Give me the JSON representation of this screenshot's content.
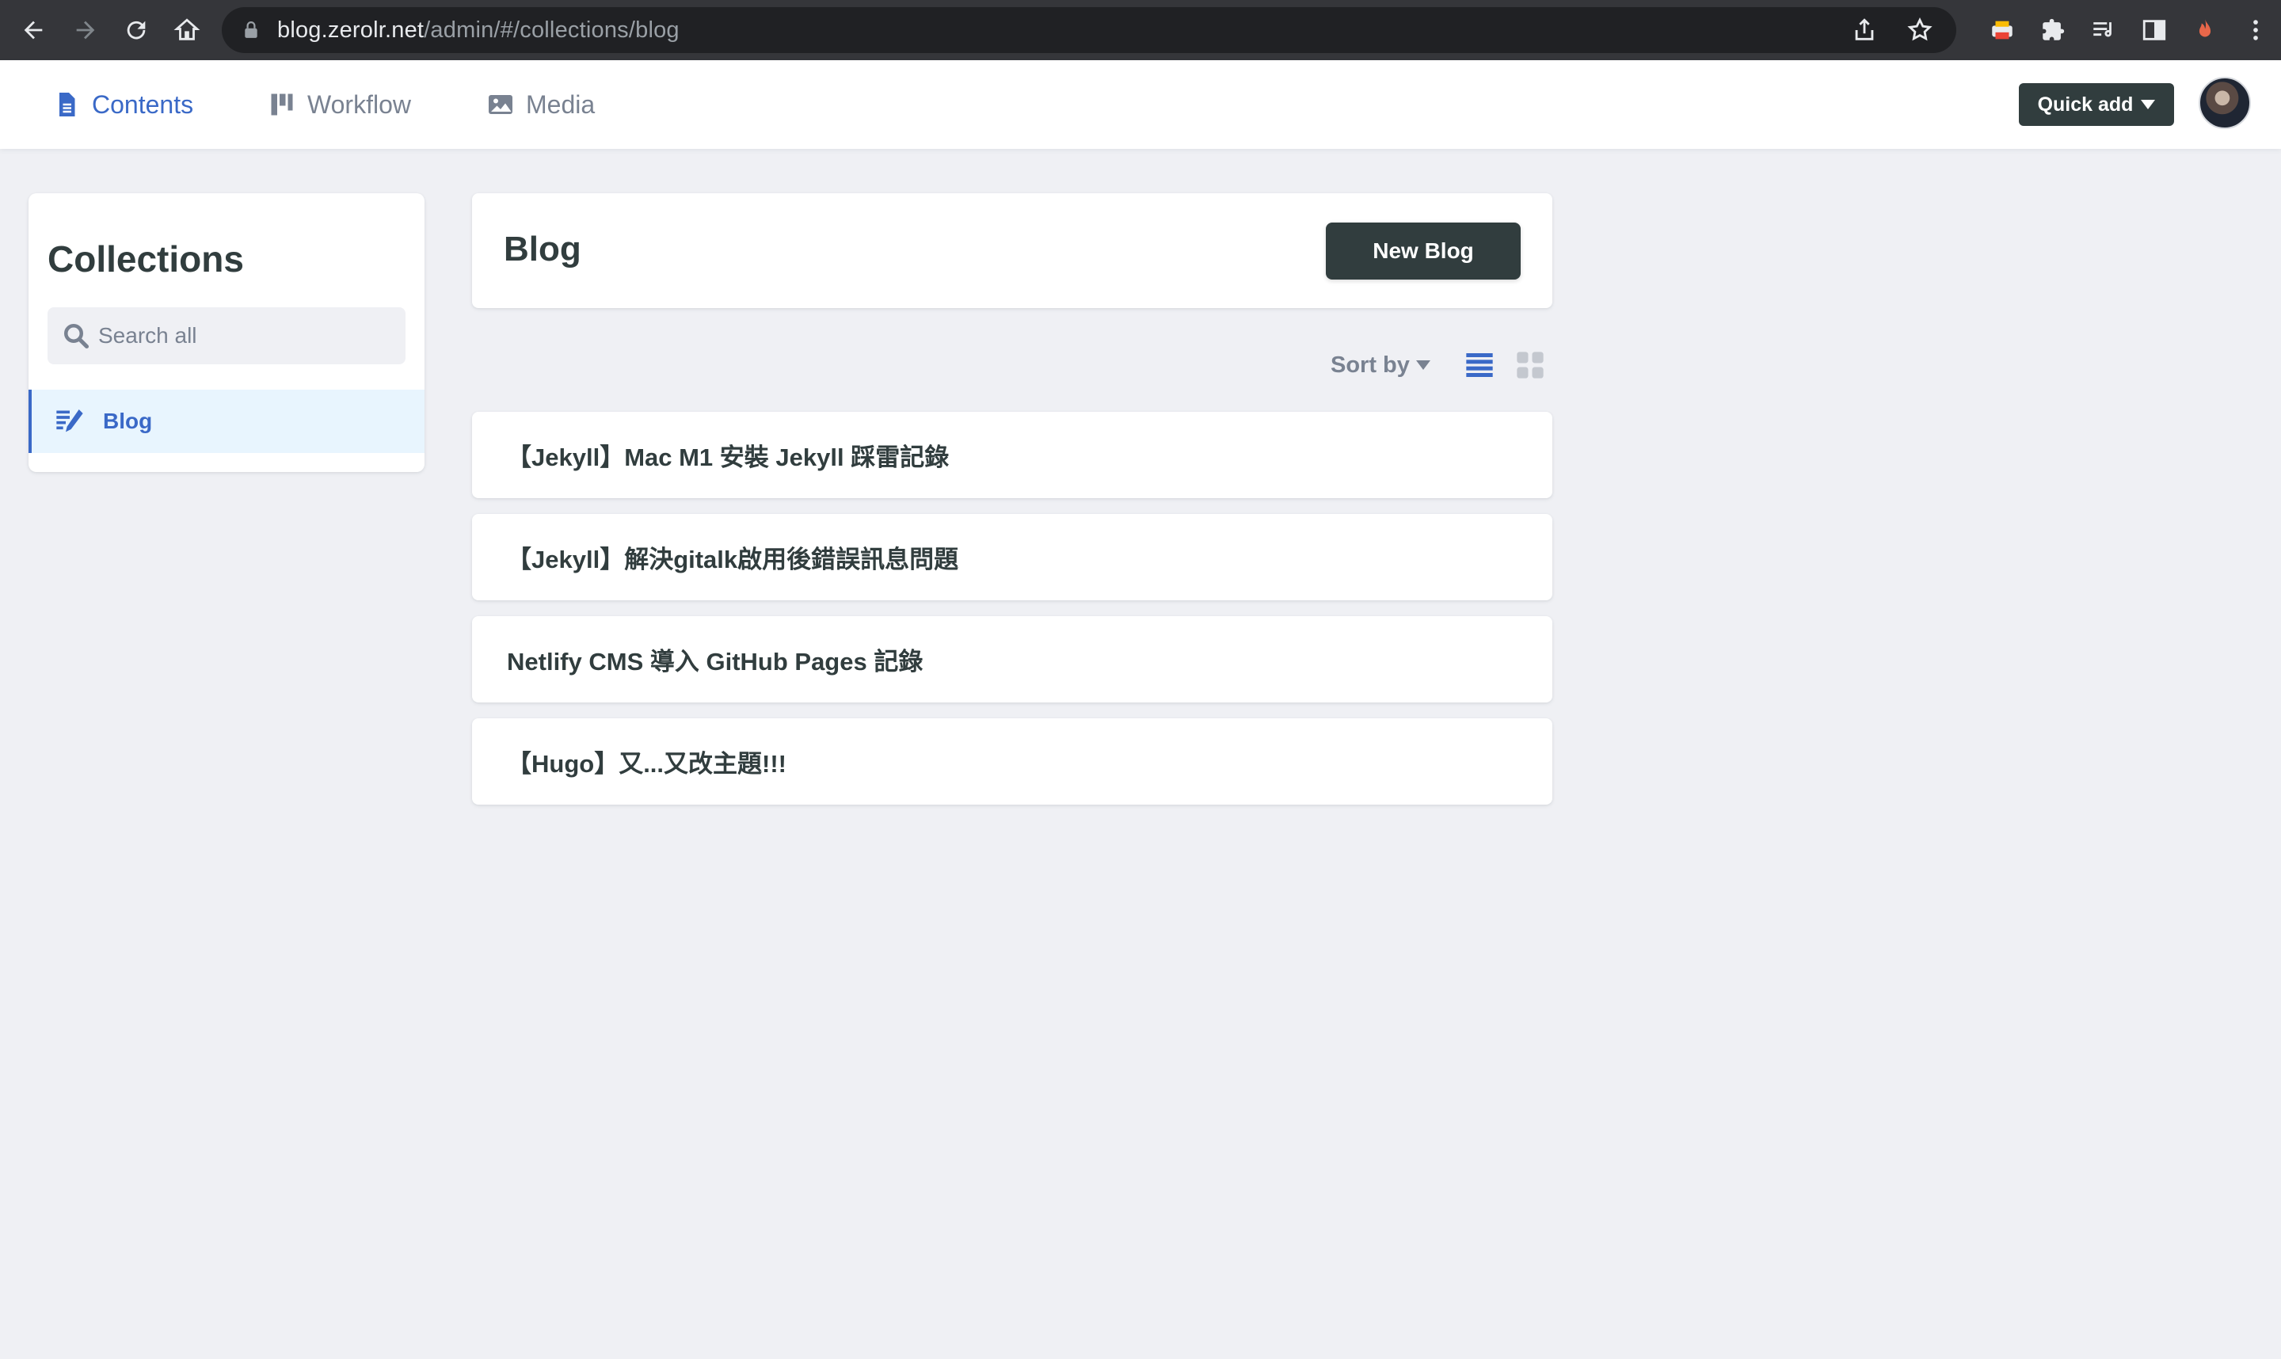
{
  "browser": {
    "url_host": "blog.zerolr.net",
    "url_path": "/admin/#/collections/blog"
  },
  "nav": {
    "items": [
      {
        "label": "Contents",
        "icon": "document-icon",
        "active": true
      },
      {
        "label": "Workflow",
        "icon": "kanban-icon",
        "active": false
      },
      {
        "label": "Media",
        "icon": "image-icon",
        "active": false
      }
    ],
    "quick_add_label": "Quick add"
  },
  "sidebar": {
    "title": "Collections",
    "search_placeholder": "Search all",
    "items": [
      {
        "label": "Blog",
        "icon": "write-icon",
        "active": true
      }
    ]
  },
  "main": {
    "title": "Blog",
    "new_button_label": "New Blog",
    "sort_label": "Sort by",
    "view_mode": "list",
    "entries": [
      {
        "title": "【Jekyll】Mac M1 安裝 Jekyll 踩雷記錄"
      },
      {
        "title": "【Jekyll】解決gitalk啟用後錯誤訊息問題"
      },
      {
        "title": "Netlify CMS 導入 GitHub Pages 記錄"
      },
      {
        "title": "【Hugo】又...又改主題!!!"
      }
    ]
  },
  "colors": {
    "accent": "#3a69c7",
    "dark": "#313d3e",
    "muted": "#798291",
    "background": "#eff0f4"
  }
}
